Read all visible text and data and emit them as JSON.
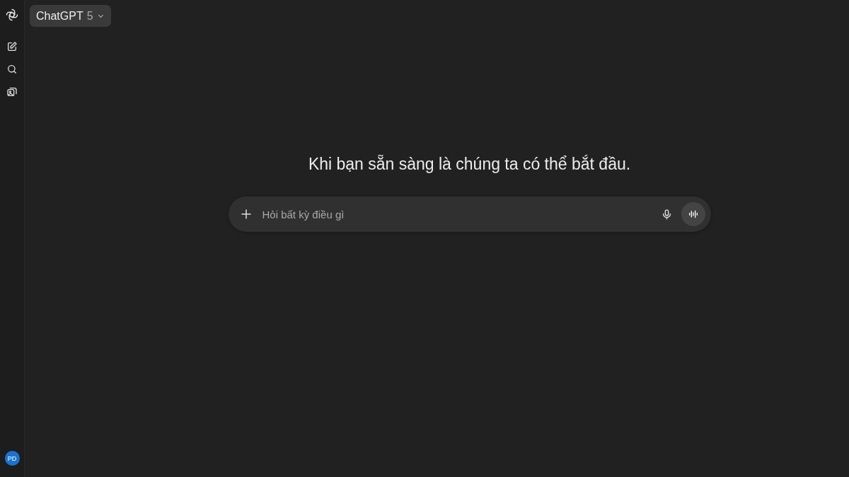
{
  "model_selector": {
    "name": "ChatGPT",
    "version": "5"
  },
  "heading": "Khi bạn sẵn sàng là chúng ta có thể bắt đầu.",
  "composer": {
    "placeholder": "Hỏi bất kỳ điều gì"
  },
  "user": {
    "initials": "PD"
  }
}
